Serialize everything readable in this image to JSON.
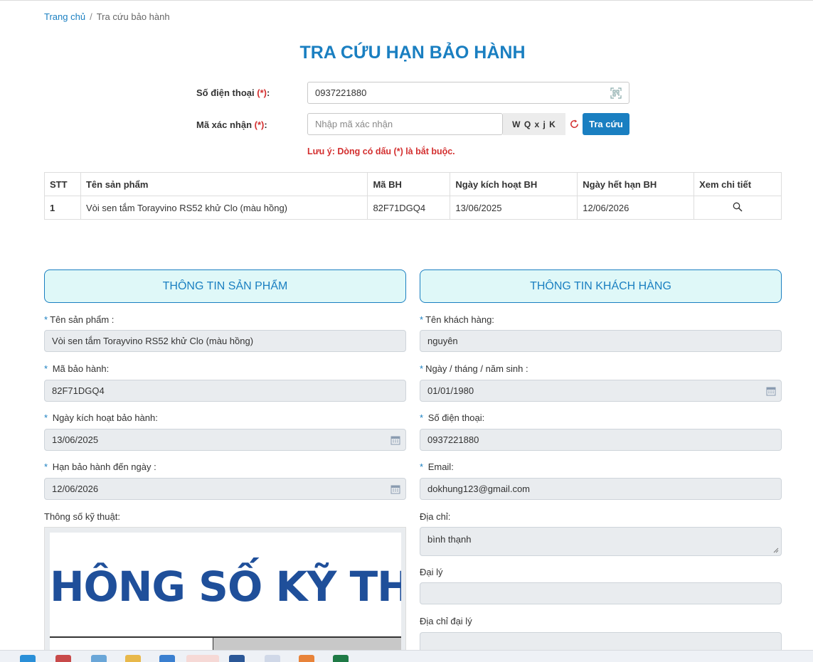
{
  "breadcrumb": {
    "home": "Trang chủ",
    "separator": "/",
    "current": "Tra cứu bảo hành"
  },
  "page_title": "TRA CỨU HẠN BẢO HÀNH",
  "lookup_form": {
    "phone_label": "Số điện thoại",
    "required_mark": "(*)",
    "colon": ":",
    "phone_value": "0937221880",
    "code_label": "Mã xác nhận",
    "code_placeholder": "Nhập mã xác nhận",
    "captcha_text": "W Q x j K",
    "search_button": "Tra cứu",
    "note": "Lưu ý: Dòng có dấu (*) là bắt buộc."
  },
  "results_table": {
    "headers": [
      "STT",
      "Tên sản phẩm",
      "Mã BH",
      "Ngày kích hoạt BH",
      "Ngày hết hạn BH",
      "Xem chi tiết"
    ],
    "rows": [
      {
        "stt": "1",
        "product": "Vòi sen tắm Torayvino RS52 khử Clo (màu hồng)",
        "code": "82F71DGQ4",
        "activated": "13/06/2025",
        "expires": "12/06/2026"
      }
    ]
  },
  "product_info": {
    "heading": "THÔNG TIN SẢN PHẨM",
    "name_label": "Tên sản phẩm :",
    "name_value": "Vòi sen tắm  Torayvino RS52 khử Clo (màu hồng)",
    "code_label": "Mã bảo hành:",
    "code_value": "82F71DGQ4",
    "activated_label": "Ngày kích hoạt bảo hành:",
    "activated_value": "13/06/2025",
    "expiry_label": "Hạn bảo hành đến ngày :",
    "expiry_value": "12/06/2026",
    "specs_label": "Thông số kỹ thuật:",
    "specs_image_text": "HÔNG SỐ KỸ THUẬT"
  },
  "customer_info": {
    "heading": "THÔNG TIN KHÁCH HÀNG",
    "name_label": "Tên khách hàng:",
    "name_value": "nguyên",
    "dob_label": "Ngày / tháng / năm sinh :",
    "dob_value": "01/01/1980",
    "phone_label": "Số điện thoại:",
    "phone_value": "0937221880",
    "email_label": "Email:",
    "email_value": "dokhung123@gmail.com",
    "address_label": "Địa chỉ:",
    "address_value": "bình thạnh",
    "dealer_label": "Đại lý",
    "dealer_value": "",
    "dealer_address_label": "Địa chỉ đại lý",
    "dealer_address_value": ""
  },
  "required_star": "*",
  "colors": {
    "primary": "#1a7fc1",
    "required": "#d32f2f",
    "section_bg": "#dff8f8",
    "readonly_bg": "#e9ecef"
  }
}
